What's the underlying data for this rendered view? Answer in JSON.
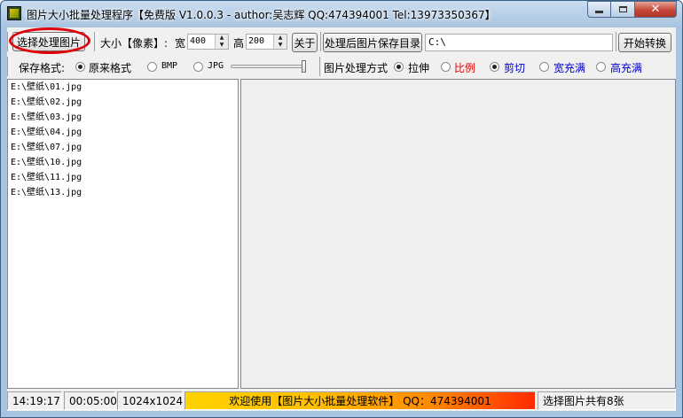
{
  "window": {
    "title": "图片大小批量处理程序【免费版 V1.0.0.3 - author:吴志辉  QQ:474394001 Tel:13973350367】",
    "controls": {
      "minimize": "minimize",
      "maximize": "maximize",
      "close": "✕"
    }
  },
  "toolbar": {
    "select_images_label": "选择处理图片",
    "size_label": "大小【像素】:",
    "width_label": "宽",
    "width_value": "400",
    "height_label": "高",
    "height_value": "200",
    "about_label": "关于",
    "output_dir_button": "处理后图片保存目录",
    "output_dir_value": "C:\\",
    "start_label": "开始转换"
  },
  "options": {
    "format_label": "保存格式:",
    "formats": [
      {
        "label": "原来格式",
        "selected": true
      },
      {
        "label": "BMP",
        "selected": false
      },
      {
        "label": "JPG",
        "selected": false
      }
    ],
    "quality_level": 1.0,
    "method_label": "图片处理方式",
    "methods": [
      {
        "label": "拉伸",
        "selected": true,
        "color": "#000000"
      },
      {
        "label": "比例",
        "selected": false,
        "color": "#e00000"
      },
      {
        "label": "剪切",
        "selected": true,
        "color": "#0000c8"
      },
      {
        "label": "宽充满",
        "selected": false,
        "color": "#0000c8"
      },
      {
        "label": "高充满",
        "selected": false,
        "color": "#0000c8"
      }
    ]
  },
  "files": [
    "E:\\壁纸\\01.jpg",
    "E:\\壁纸\\02.jpg",
    "E:\\壁纸\\03.jpg",
    "E:\\壁纸\\04.jpg",
    "E:\\壁纸\\07.jpg",
    "E:\\壁纸\\10.jpg",
    "E:\\壁纸\\11.jpg",
    "E:\\壁纸\\13.jpg"
  ],
  "statusbar": {
    "time": "14:19:17",
    "elapsed": "00:05:00",
    "resolution": "1024x1024",
    "welcome": "欢迎使用【图片大小批量处理软件】 QQ：474394001",
    "count": "选择图片共有8张"
  },
  "colors": {
    "highlight_ring": "#e00000",
    "welcome_gradient_start": "#ffd200",
    "welcome_gradient_end": "#ff2a00"
  }
}
